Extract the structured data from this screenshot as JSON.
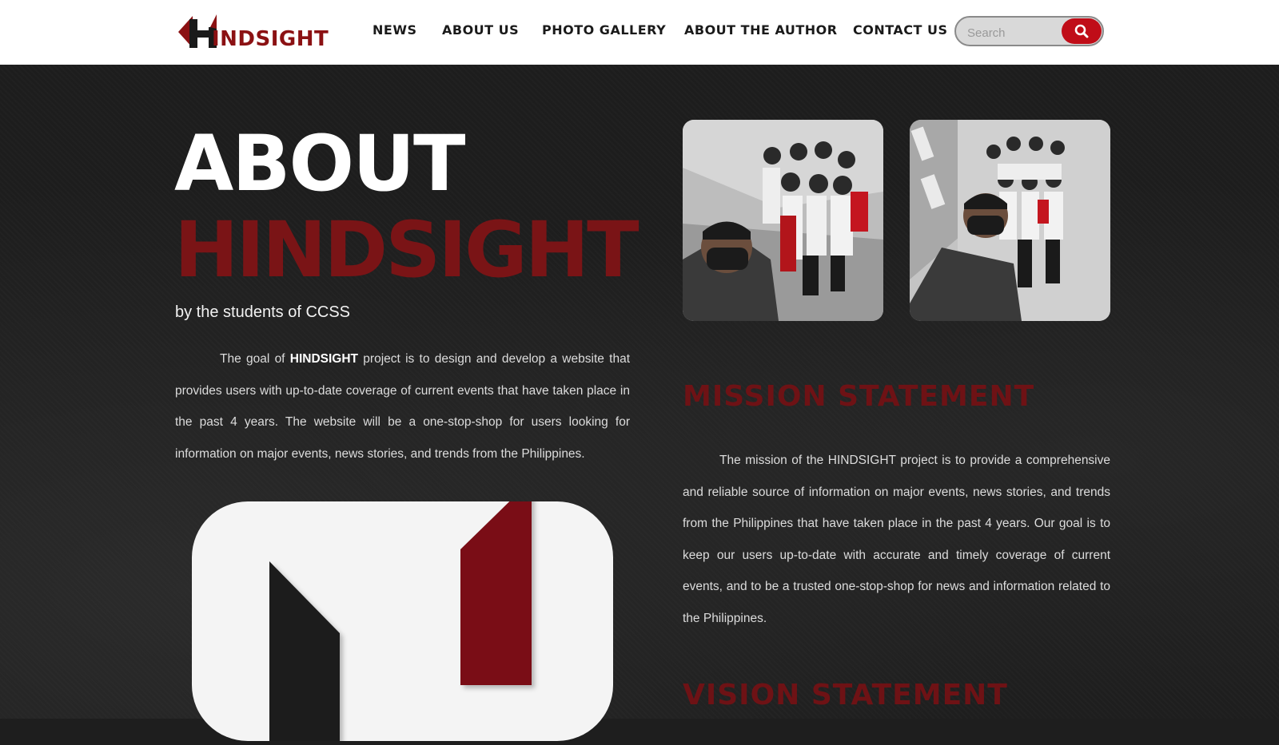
{
  "header": {
    "logo_text": "INDSIGHT",
    "nav": [
      "NEWS",
      "ABOUT US",
      "PHOTO GALLERY",
      "ABOUT THE AUTHOR",
      "CONTACT US"
    ],
    "search_placeholder": "Search"
  },
  "hero": {
    "heading_line1": "ABOUT",
    "heading_line2": "HINDSIGHT",
    "byline": "by the students of CCSS",
    "intro_prefix": "The goal of ",
    "intro_brand": "HINDSIGHT",
    "intro_rest": " project is to design and develop a website that provides users with up-to-date coverage of current events that have taken place in the past 4 years. The website will be a one-stop-shop for users looking for information on major events, news stories, and trends from the Philippines."
  },
  "mission": {
    "title": "MISSION STATEMENT",
    "body": "The mission of the HINDSIGHT project is to provide a comprehensive and reliable source of information on major events, news stories, and trends from the Philippines that have taken place in the past 4 years. Our goal is to keep our users up-to-date with accurate and timely coverage of current events, and to be a trusted one-stop-shop for news and information related to the Philippines."
  },
  "vision": {
    "title": "VISION STATEMENT"
  },
  "colors": {
    "brand_red": "#8b1113",
    "accent_red": "#c00d18",
    "background": "#1d1d1d"
  }
}
